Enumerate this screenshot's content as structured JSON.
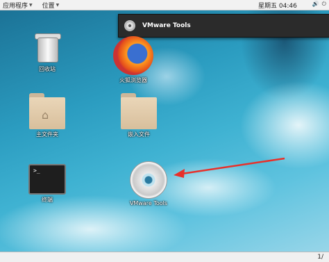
{
  "topbar": {
    "menus": [
      "应用程序",
      "位置"
    ],
    "clock": "星期五 04:46"
  },
  "notification": {
    "title": "VMware Tools",
    "icon": "cd-icon"
  },
  "desktop": {
    "icons": {
      "trash": "回收站",
      "firefox": "火狐浏览器",
      "home": "主文件夹",
      "folder": "嵌入文件",
      "terminal": "终端",
      "vmware": "VMware Tools"
    }
  },
  "bottombar": {
    "workspace": "1/"
  },
  "colors": {
    "arrow": "#e8302a",
    "topbar": "#f2f2f2"
  }
}
